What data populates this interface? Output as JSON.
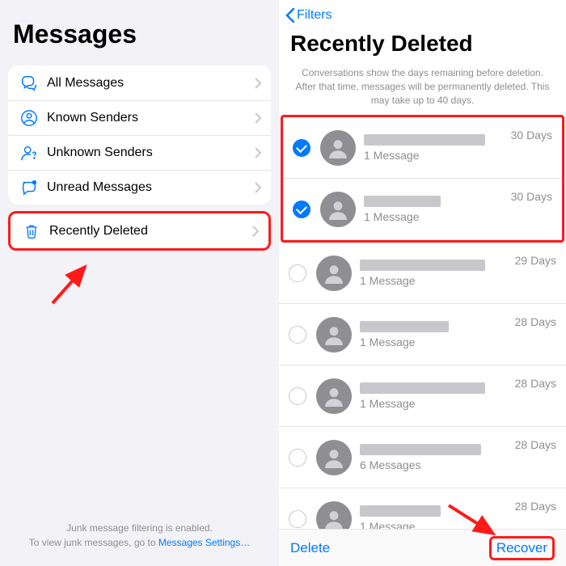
{
  "left": {
    "title": "Messages",
    "filters": [
      {
        "label": "All Messages",
        "icon": "chat-bubbles"
      },
      {
        "label": "Known Senders",
        "icon": "person-circle"
      },
      {
        "label": "Unknown Senders",
        "icon": "person-question"
      },
      {
        "label": "Unread Messages",
        "icon": "unread-bubble"
      }
    ],
    "recentlyDeleted": {
      "label": "Recently Deleted",
      "icon": "trash"
    },
    "footer1": "Junk message filtering is enabled.",
    "footer2": "To view junk messages, go to ",
    "footerLink": "Messages Settings…"
  },
  "right": {
    "back": "Filters",
    "title": "Recently Deleted",
    "subtext": "Conversations show the days remaining before deletion. After that time, messages will be permanently deleted. This may take up to 40 days.",
    "items": [
      {
        "selected": true,
        "nameWidth": 150,
        "count": "1 Message",
        "days": "30 Days"
      },
      {
        "selected": true,
        "nameWidth": 95,
        "count": "1 Message",
        "days": "30 Days"
      },
      {
        "selected": false,
        "nameWidth": 155,
        "count": "1 Message",
        "days": "29 Days"
      },
      {
        "selected": false,
        "nameWidth": 110,
        "count": "1 Message",
        "days": "28 Days"
      },
      {
        "selected": false,
        "nameWidth": 155,
        "count": "1 Message",
        "days": "28 Days"
      },
      {
        "selected": false,
        "nameWidth": 150,
        "count": "6 Messages",
        "days": "28 Days"
      },
      {
        "selected": false,
        "nameWidth": 100,
        "count": "1 Message",
        "days": "28 Days"
      }
    ],
    "delete": "Delete",
    "recover": "Recover"
  }
}
